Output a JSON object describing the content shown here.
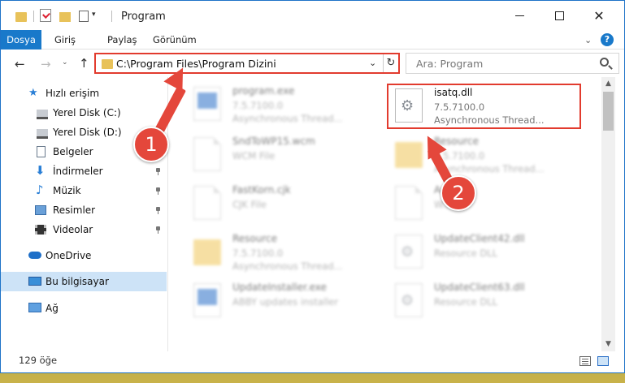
{
  "window": {
    "title": "Program"
  },
  "ribbon": {
    "tabs": [
      {
        "label": "Dosya"
      },
      {
        "label": "Giriş"
      },
      {
        "label": "Paylaş"
      },
      {
        "label": "Görünüm"
      }
    ],
    "help": "?"
  },
  "nav": {
    "address": "C:\\Program Files\\Program Dizini",
    "search_placeholder": "Ara: Program"
  },
  "sidebar": {
    "items": [
      {
        "label": "Hızlı erişim",
        "icon": "star-icon"
      },
      {
        "label": "Yerel Disk (C:)",
        "icon": "drive-icon"
      },
      {
        "label": "Yerel Disk (D:)",
        "icon": "drive-icon"
      },
      {
        "label": "Belgeler",
        "icon": "documents-icon"
      },
      {
        "label": "İndirmeler",
        "icon": "download-icon"
      },
      {
        "label": "Müzik",
        "icon": "music-icon"
      },
      {
        "label": "Resimler",
        "icon": "pictures-icon"
      },
      {
        "label": "Videolar",
        "icon": "video-icon"
      },
      {
        "label": "OneDrive",
        "icon": "cloud-icon"
      },
      {
        "label": "Bu bilgisayar",
        "icon": "computer-icon"
      },
      {
        "label": "Ağ",
        "icon": "network-icon"
      }
    ]
  },
  "files": [
    {
      "name": "program.exe",
      "line2": "7.5.7100.0",
      "line3": "Asynchronous Thread...",
      "icon": "exe-icon"
    },
    {
      "name": "isatq.dll",
      "line2": "7.5.7100.0",
      "line3": "Asynchronous Thread...",
      "icon": "dll-gear-icon"
    },
    {
      "name": "SndToWP15.wcm",
      "line2": "WCM File",
      "line3": "",
      "icon": "file-icon"
    },
    {
      "name": "Resource",
      "line2": "7.5.7100.0",
      "line3": "Asynchronous Thread...",
      "icon": "folder-icon"
    },
    {
      "name": "FastKorn.cjk",
      "line2": "CJK File",
      "line3": "",
      "icon": "file-icon"
    },
    {
      "name": "Ara...d",
      "line2": "W...",
      "line3": "",
      "icon": "file-icon"
    },
    {
      "name": "Resource",
      "line2": "7.5.7100.0",
      "line3": "Asynchronous Thread...",
      "icon": "folder-icon"
    },
    {
      "name": "UpdateClient42.dll",
      "line2": "Resource DLL",
      "line3": "",
      "icon": "dll-gear-icon"
    },
    {
      "name": "UpdateInstaller.exe",
      "line2": "ABBY updates installer",
      "line3": "",
      "icon": "exe-icon"
    },
    {
      "name": "UpdateClient63.dll",
      "line2": "Resource DLL",
      "line3": "",
      "icon": "dll-gear-icon"
    }
  ],
  "status": {
    "count": "129 öğe"
  },
  "annotations": {
    "step1": "1",
    "step2": "2"
  },
  "colors": {
    "accent": "#1979ca",
    "highlight": "#e23b2e",
    "selected": "#cde3f7"
  }
}
